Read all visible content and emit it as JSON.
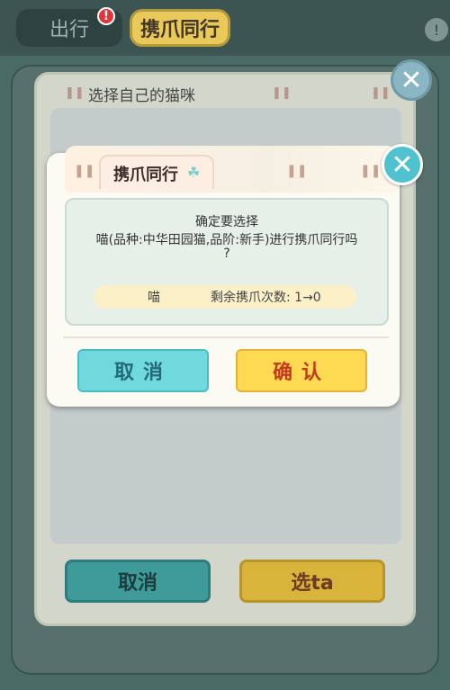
{
  "tabs": {
    "outing_label": "出行",
    "paw_together_label": "携爪同行",
    "badge_text": "!"
  },
  "top_close": "!",
  "bg_dialog": {
    "title": "选择自己的猫咪",
    "close": "✕",
    "cancel_label": "取消",
    "select_label": "选ta"
  },
  "confirm_dialog": {
    "title": "携爪同行",
    "clover": "☘",
    "close": "✕",
    "line1": "确定要选择",
    "line2": "喵(品种:中华田园猫,品阶:新手)进行携爪同行吗",
    "line3": "?",
    "cat_name": "喵",
    "remaining": "剩余携爪次数: 1→0",
    "cancel_label": "取消",
    "confirm_label": "确认"
  },
  "colors": {
    "cancel_teal": "#6fd9de",
    "confirm_yellow": "#ffd951",
    "confirm_text": "#c43a1f"
  }
}
